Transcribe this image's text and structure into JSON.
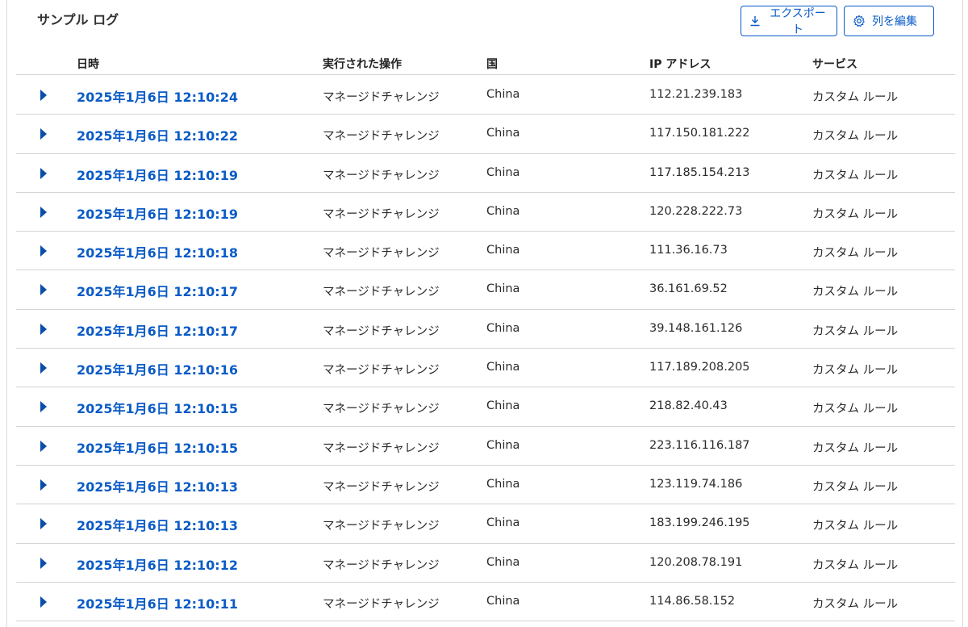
{
  "title": "サンプル ログ",
  "toolbar": {
    "export_label": "エクスポート",
    "edit_columns_label": "列を編集",
    "accent_color": "#0a5bc7"
  },
  "columns": {
    "datetime": "日時",
    "action": "実行された操作",
    "country": "国",
    "ip": "IP アドレス",
    "service": "サービス"
  },
  "rows": [
    {
      "datetime": "2025年1月6日 12:10:24",
      "action": "マネージドチャレンジ",
      "country": "China",
      "ip": "112.21.239.183",
      "service": "カスタム ルール"
    },
    {
      "datetime": "2025年1月6日 12:10:22",
      "action": "マネージドチャレンジ",
      "country": "China",
      "ip": "117.150.181.222",
      "service": "カスタム ルール"
    },
    {
      "datetime": "2025年1月6日 12:10:19",
      "action": "マネージドチャレンジ",
      "country": "China",
      "ip": "117.185.154.213",
      "service": "カスタム ルール"
    },
    {
      "datetime": "2025年1月6日 12:10:19",
      "action": "マネージドチャレンジ",
      "country": "China",
      "ip": "120.228.222.73",
      "service": "カスタム ルール"
    },
    {
      "datetime": "2025年1月6日 12:10:18",
      "action": "マネージドチャレンジ",
      "country": "China",
      "ip": "111.36.16.73",
      "service": "カスタム ルール"
    },
    {
      "datetime": "2025年1月6日 12:10:17",
      "action": "マネージドチャレンジ",
      "country": "China",
      "ip": "36.161.69.52",
      "service": "カスタム ルール"
    },
    {
      "datetime": "2025年1月6日 12:10:17",
      "action": "マネージドチャレンジ",
      "country": "China",
      "ip": "39.148.161.126",
      "service": "カスタム ルール"
    },
    {
      "datetime": "2025年1月6日 12:10:16",
      "action": "マネージドチャレンジ",
      "country": "China",
      "ip": "117.189.208.205",
      "service": "カスタム ルール"
    },
    {
      "datetime": "2025年1月6日 12:10:15",
      "action": "マネージドチャレンジ",
      "country": "China",
      "ip": "218.82.40.43",
      "service": "カスタム ルール"
    },
    {
      "datetime": "2025年1月6日 12:10:15",
      "action": "マネージドチャレンジ",
      "country": "China",
      "ip": "223.116.116.187",
      "service": "カスタム ルール"
    },
    {
      "datetime": "2025年1月6日 12:10:13",
      "action": "マネージドチャレンジ",
      "country": "China",
      "ip": "123.119.74.186",
      "service": "カスタム ルール"
    },
    {
      "datetime": "2025年1月6日 12:10:13",
      "action": "マネージドチャレンジ",
      "country": "China",
      "ip": "183.199.246.195",
      "service": "カスタム ルール"
    },
    {
      "datetime": "2025年1月6日 12:10:12",
      "action": "マネージドチャレンジ",
      "country": "China",
      "ip": "120.208.78.191",
      "service": "カスタム ルール"
    },
    {
      "datetime": "2025年1月6日 12:10:11",
      "action": "マネージドチャレンジ",
      "country": "China",
      "ip": "114.86.58.152",
      "service": "カスタム ルール"
    }
  ]
}
